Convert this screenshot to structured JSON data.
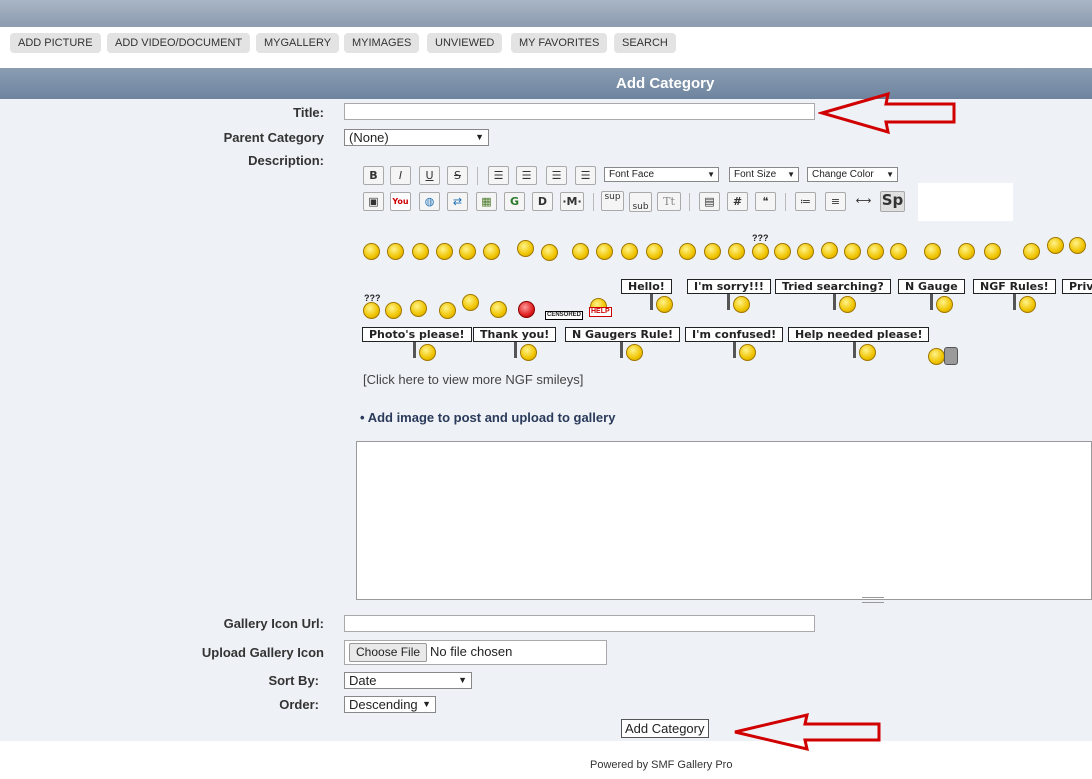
{
  "nav": {
    "items": [
      "ADD PICTURE",
      "ADD VIDEO/DOCUMENT",
      "MYGALLERY",
      "MYIMAGES",
      "UNVIEWED",
      "MY FAVORITES",
      "SEARCH"
    ]
  },
  "header": {
    "title": "Add Category"
  },
  "form": {
    "title_label": "Title:",
    "title_value": "",
    "parent_label": "Parent Category",
    "parent_value": "(None)",
    "description_label": "Description:",
    "icon_url_label": "Gallery Icon Url:",
    "icon_url_value": "",
    "upload_label": "Upload Gallery Icon",
    "choose_file": "Choose File",
    "no_file": "No file chosen",
    "sortby_label": "Sort By:",
    "sortby_value": "Date",
    "order_label": "Order:",
    "order_value": "Descending",
    "submit_label": "Add Category"
  },
  "toolbar": {
    "row1": [
      "B",
      "I",
      "U",
      "S",
      "align-left",
      "align-justify",
      "align-center",
      "align-right"
    ],
    "row2": [
      "image",
      "youtube",
      "globe",
      "swap",
      "picture",
      "G",
      "D",
      "M",
      "sup",
      "sub",
      "Tt",
      "table",
      "#",
      "quote",
      "list",
      "ordered-list",
      "horizontal-rule",
      "Sp"
    ],
    "font_face": "Font Face",
    "font_size": "Font Size",
    "change_color": "Change Color"
  },
  "smileys": {
    "signs_row1": [
      "Hello!",
      "I'm sorry!!!",
      "Tried searching?",
      "N Gauge",
      "NGF Rules!",
      "Priv"
    ],
    "signs_row2": [
      "Photo's please!",
      "Thank you!",
      "N Gaugers Rule!",
      "I'm confused!",
      "Help needed please!"
    ],
    "more_link": "[Click here to view more NGF smileys]",
    "small_text": [
      "???",
      "???",
      "CENSORED",
      "HELP"
    ]
  },
  "attach": {
    "label": "Add image to post and upload to gallery"
  },
  "footer": {
    "text": "Powered by SMF Gallery Pro"
  },
  "colors": {
    "header_bg": "#7d92ab",
    "form_bg": "#eef1f5",
    "arrow": "#d10000"
  }
}
